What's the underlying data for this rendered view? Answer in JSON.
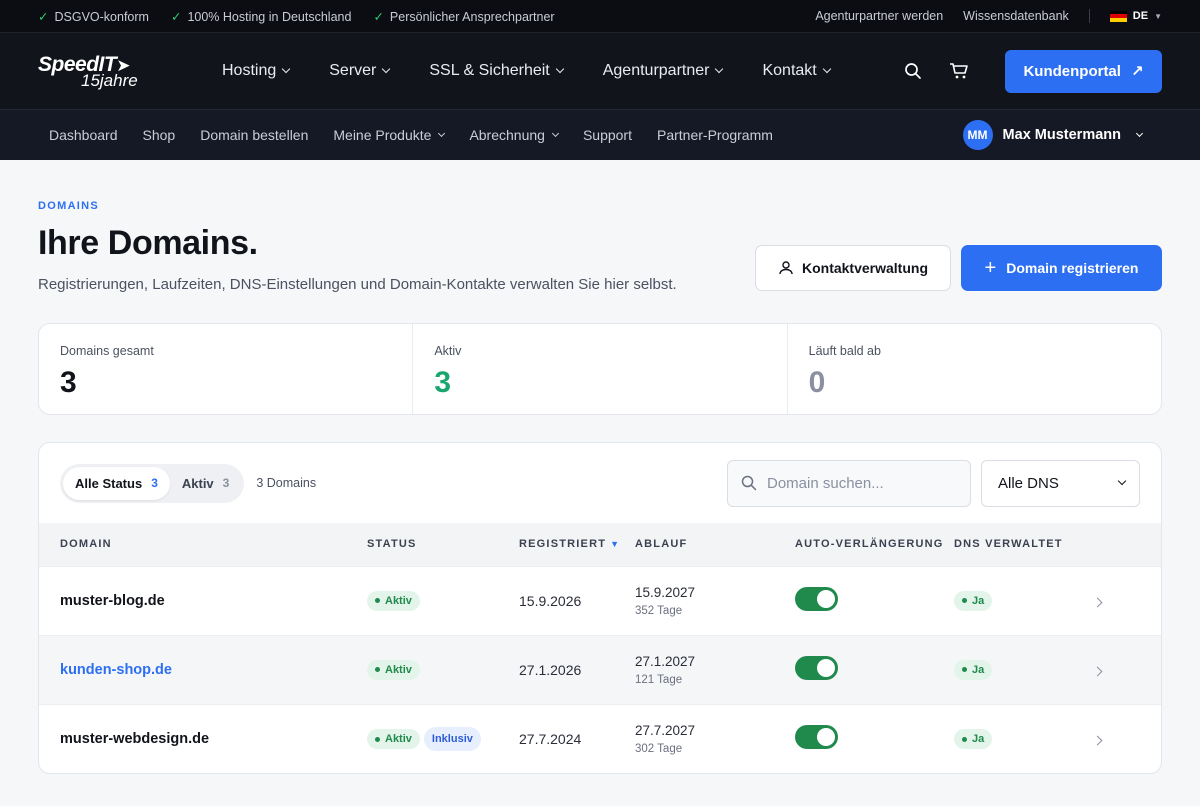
{
  "topbar": {
    "features": [
      "DSGVO-konform",
      "100% Hosting in Deutschland",
      "Persönlicher Ansprechpartner"
    ],
    "links": [
      "Agenturpartner werden",
      "Wissensdatenbank"
    ],
    "lang": "DE"
  },
  "logo": {
    "line1": "SpeedIT",
    "line2": "15jahre"
  },
  "nav": {
    "items": [
      "Hosting",
      "Server",
      "SSL & Sicherheit",
      "Agenturpartner",
      "Kontakt"
    ],
    "portal": "Kundenportal"
  },
  "subnav": {
    "items": [
      "Dashboard",
      "Shop",
      "Domain bestellen",
      "Meine Produkte",
      "Abrechnung",
      "Support",
      "Partner-Programm"
    ],
    "user_initials": "MM",
    "user_name": "Max Mustermann"
  },
  "page": {
    "eyebrow": "DOMAINS",
    "title": "Ihre Domains.",
    "subtitle": "Registrierungen, Laufzeiten, DNS-Einstellungen und Domain-Kontakte verwalten Sie hier selbst.",
    "contacts_button": "Kontaktverwaltung",
    "register_button": "Domain registrieren"
  },
  "stats": [
    {
      "label": "Domains gesamt",
      "value": "3",
      "color": "#11141b"
    },
    {
      "label": "Aktiv",
      "value": "3",
      "color": "#1aa66e"
    },
    {
      "label": "Läuft bald ab",
      "value": "0",
      "color": "#8a90a0"
    }
  ],
  "filters": {
    "tabs": [
      {
        "label": "Alle Status",
        "count": "3"
      },
      {
        "label": "Aktiv",
        "count": "3"
      }
    ],
    "domain_count": "3 Domains",
    "search_placeholder": "Domain suchen...",
    "dns_select": "Alle DNS"
  },
  "table": {
    "headers": [
      "DOMAIN",
      "STATUS",
      "REGISTRIERT",
      "ABLAUF",
      "AUTO-VERLÄNGERUNG",
      "DNS VERWALTET"
    ],
    "rows": [
      {
        "domain": "muster-blog.de",
        "status": "Aktiv",
        "extra": "",
        "registered": "15.9.2026",
        "expires": "15.9.2027",
        "days": "352 Tage",
        "dns": "Ja"
      },
      {
        "domain": "kunden-shop.de",
        "status": "Aktiv",
        "extra": "",
        "registered": "27.1.2026",
        "expires": "27.1.2027",
        "days": "121 Tage",
        "dns": "Ja"
      },
      {
        "domain": "muster-webdesign.de",
        "status": "Aktiv",
        "extra": "Inklusiv",
        "registered": "27.7.2024",
        "expires": "27.7.2027",
        "days": "302 Tage",
        "dns": "Ja"
      }
    ]
  }
}
